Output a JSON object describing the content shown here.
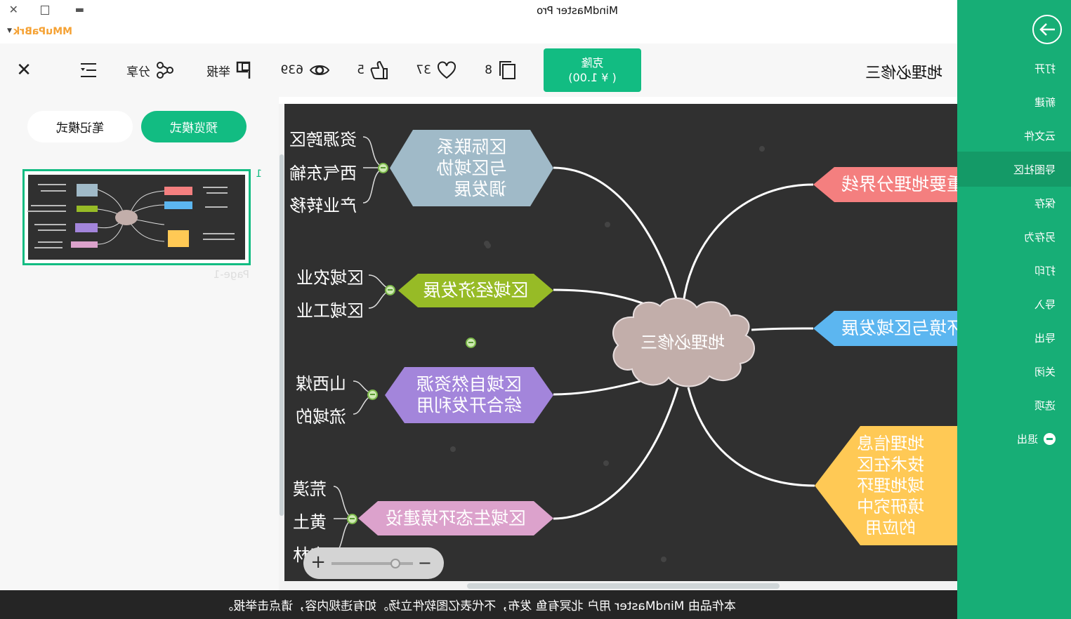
{
  "window": {
    "title": "MindMaster Pro",
    "controls": [
      "minimize-icon",
      "maximize-icon",
      "close-icon"
    ]
  },
  "user": {
    "name": "MMuPaBrk"
  },
  "sidebar": {
    "accent": "#17ae76",
    "items": [
      {
        "label": "打开"
      },
      {
        "label": "新建"
      },
      {
        "label": "云文件"
      },
      {
        "label": "导图社区",
        "active": true
      },
      {
        "label": "保存"
      },
      {
        "label": "另存为"
      },
      {
        "label": "打印"
      },
      {
        "label": "导入"
      },
      {
        "label": "导出"
      },
      {
        "label": "关闭"
      },
      {
        "label": "选项"
      },
      {
        "label": "退出"
      }
    ]
  },
  "toolbar": {
    "doc_title": "地理必修三",
    "clone_label": "克隆",
    "clone_price": "( ¥ 1.00)",
    "copies": "8",
    "likes_heart": "37",
    "thumbs": "5",
    "views": "639",
    "report": "举报",
    "share": "分享"
  },
  "panel": {
    "preview_mode": "预览模式",
    "note_mode": "笔记模式",
    "page_number": "1",
    "page_label": "Page-1"
  },
  "mindmap": {
    "center": "地理必修三",
    "left_nodes": [
      {
        "text": "重要地理分界线",
        "color": "#f47f7f"
      },
      {
        "text": "环境与区域发展",
        "color": "#5cb6f0"
      },
      {
        "lines": [
          "地理信息",
          "技术在区",
          "域地理环",
          "境研究中",
          "的应用"
        ],
        "color": "#ffc955"
      }
    ],
    "right_nodes": [
      {
        "lines": [
          "区际联系",
          "与区域协",
          "调发展"
        ],
        "color": "#a0bac8",
        "children": [
          "资源跨区",
          "西气东输",
          "产业转移"
        ]
      },
      {
        "text": "区域经济发展",
        "color": "#97bb26",
        "children": [
          "区域农业",
          "区域工业"
        ]
      },
      {
        "lines": [
          "区域自然资源",
          "综合开发利用"
        ],
        "color": "#a385db",
        "children": [
          "山西煤",
          "流域的"
        ]
      },
      {
        "text": "区域生态环境建设",
        "color": "#dca2cc",
        "children": [
          "荒漠",
          "黄土",
          "森林"
        ]
      }
    ]
  },
  "zoom": {
    "minus": "−",
    "plus": "+",
    "level_fraction": 0.25
  },
  "footer": {
    "notice": "本作品由 MindMaster 用户 北冥有鱼 发布，不代表亿图软件立场。如有违规内容，请点击举报。"
  }
}
